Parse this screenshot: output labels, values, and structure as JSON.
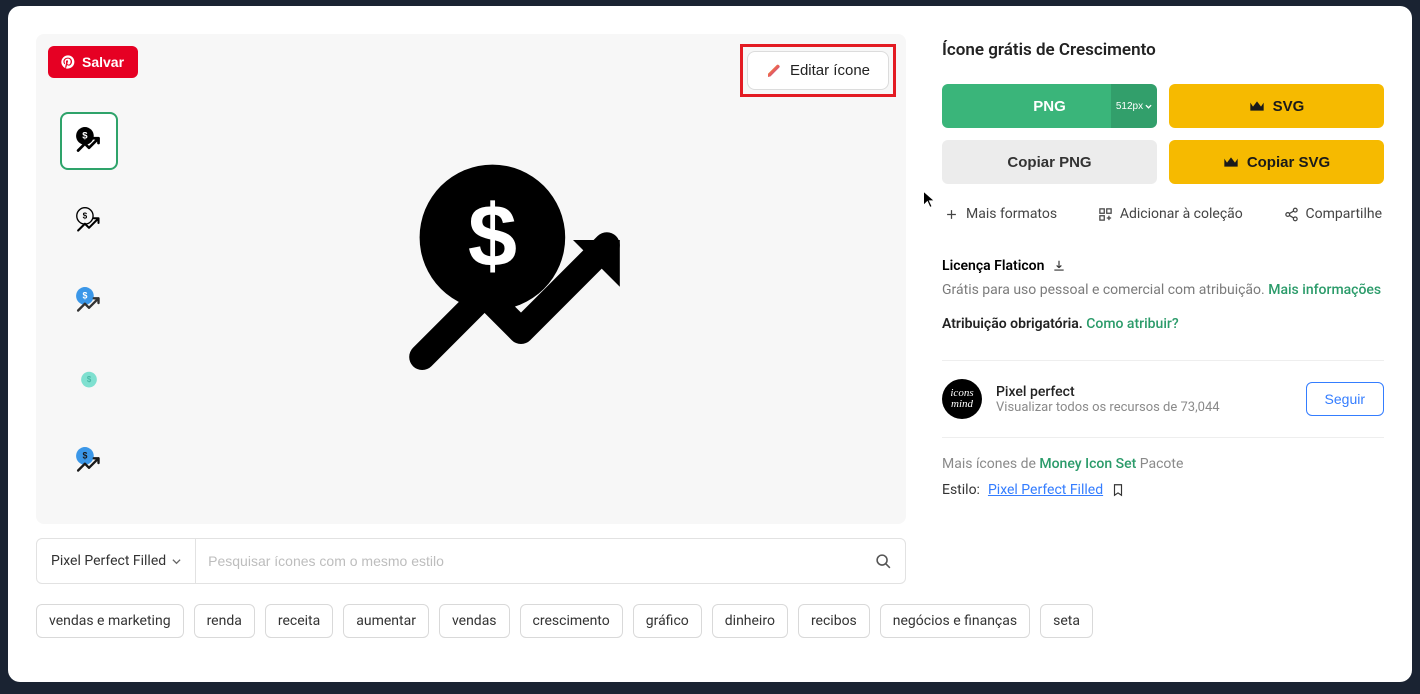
{
  "header": {
    "save": "Salvar",
    "edit": "Editar ícone"
  },
  "title": "Ícone grátis de Crescimento",
  "download": {
    "png": "PNG",
    "png_size": "512px",
    "svg": "SVG",
    "copy_png": "Copiar PNG",
    "copy_svg": "Copiar SVG"
  },
  "secondary": {
    "formats": "Mais formatos",
    "collect": "Adicionar à coleção",
    "share": "Compartilhe"
  },
  "license": {
    "label": "Licença Flaticon",
    "sub": "Grátis para uso pessoal e comercial com atribuição.",
    "more": "Mais informações"
  },
  "attribution": {
    "label": "Atribuição obrigatória.",
    "link": "Como atribuir?"
  },
  "author": {
    "name": "Pixel perfect",
    "resources_prefix": "Visualizar todos os recursos de ",
    "resources_count": "73,044",
    "follow": "Seguir",
    "avatar": "icons mind"
  },
  "pack": {
    "prefix": "Mais ícones de ",
    "name": "Money Icon Set",
    "suffix": " Pacote"
  },
  "style": {
    "label": "Estilo:",
    "value": "Pixel Perfect Filled"
  },
  "styleFilter": {
    "value": "Pixel Perfect Filled"
  },
  "search": {
    "placeholder": "Pesquisar ícones com o mesmo estilo"
  },
  "tags": [
    "vendas e marketing",
    "renda",
    "receita",
    "aumentar",
    "vendas",
    "crescimento",
    "gráfico",
    "dinheiro",
    "recibos",
    "negócios e finanças",
    "seta"
  ]
}
